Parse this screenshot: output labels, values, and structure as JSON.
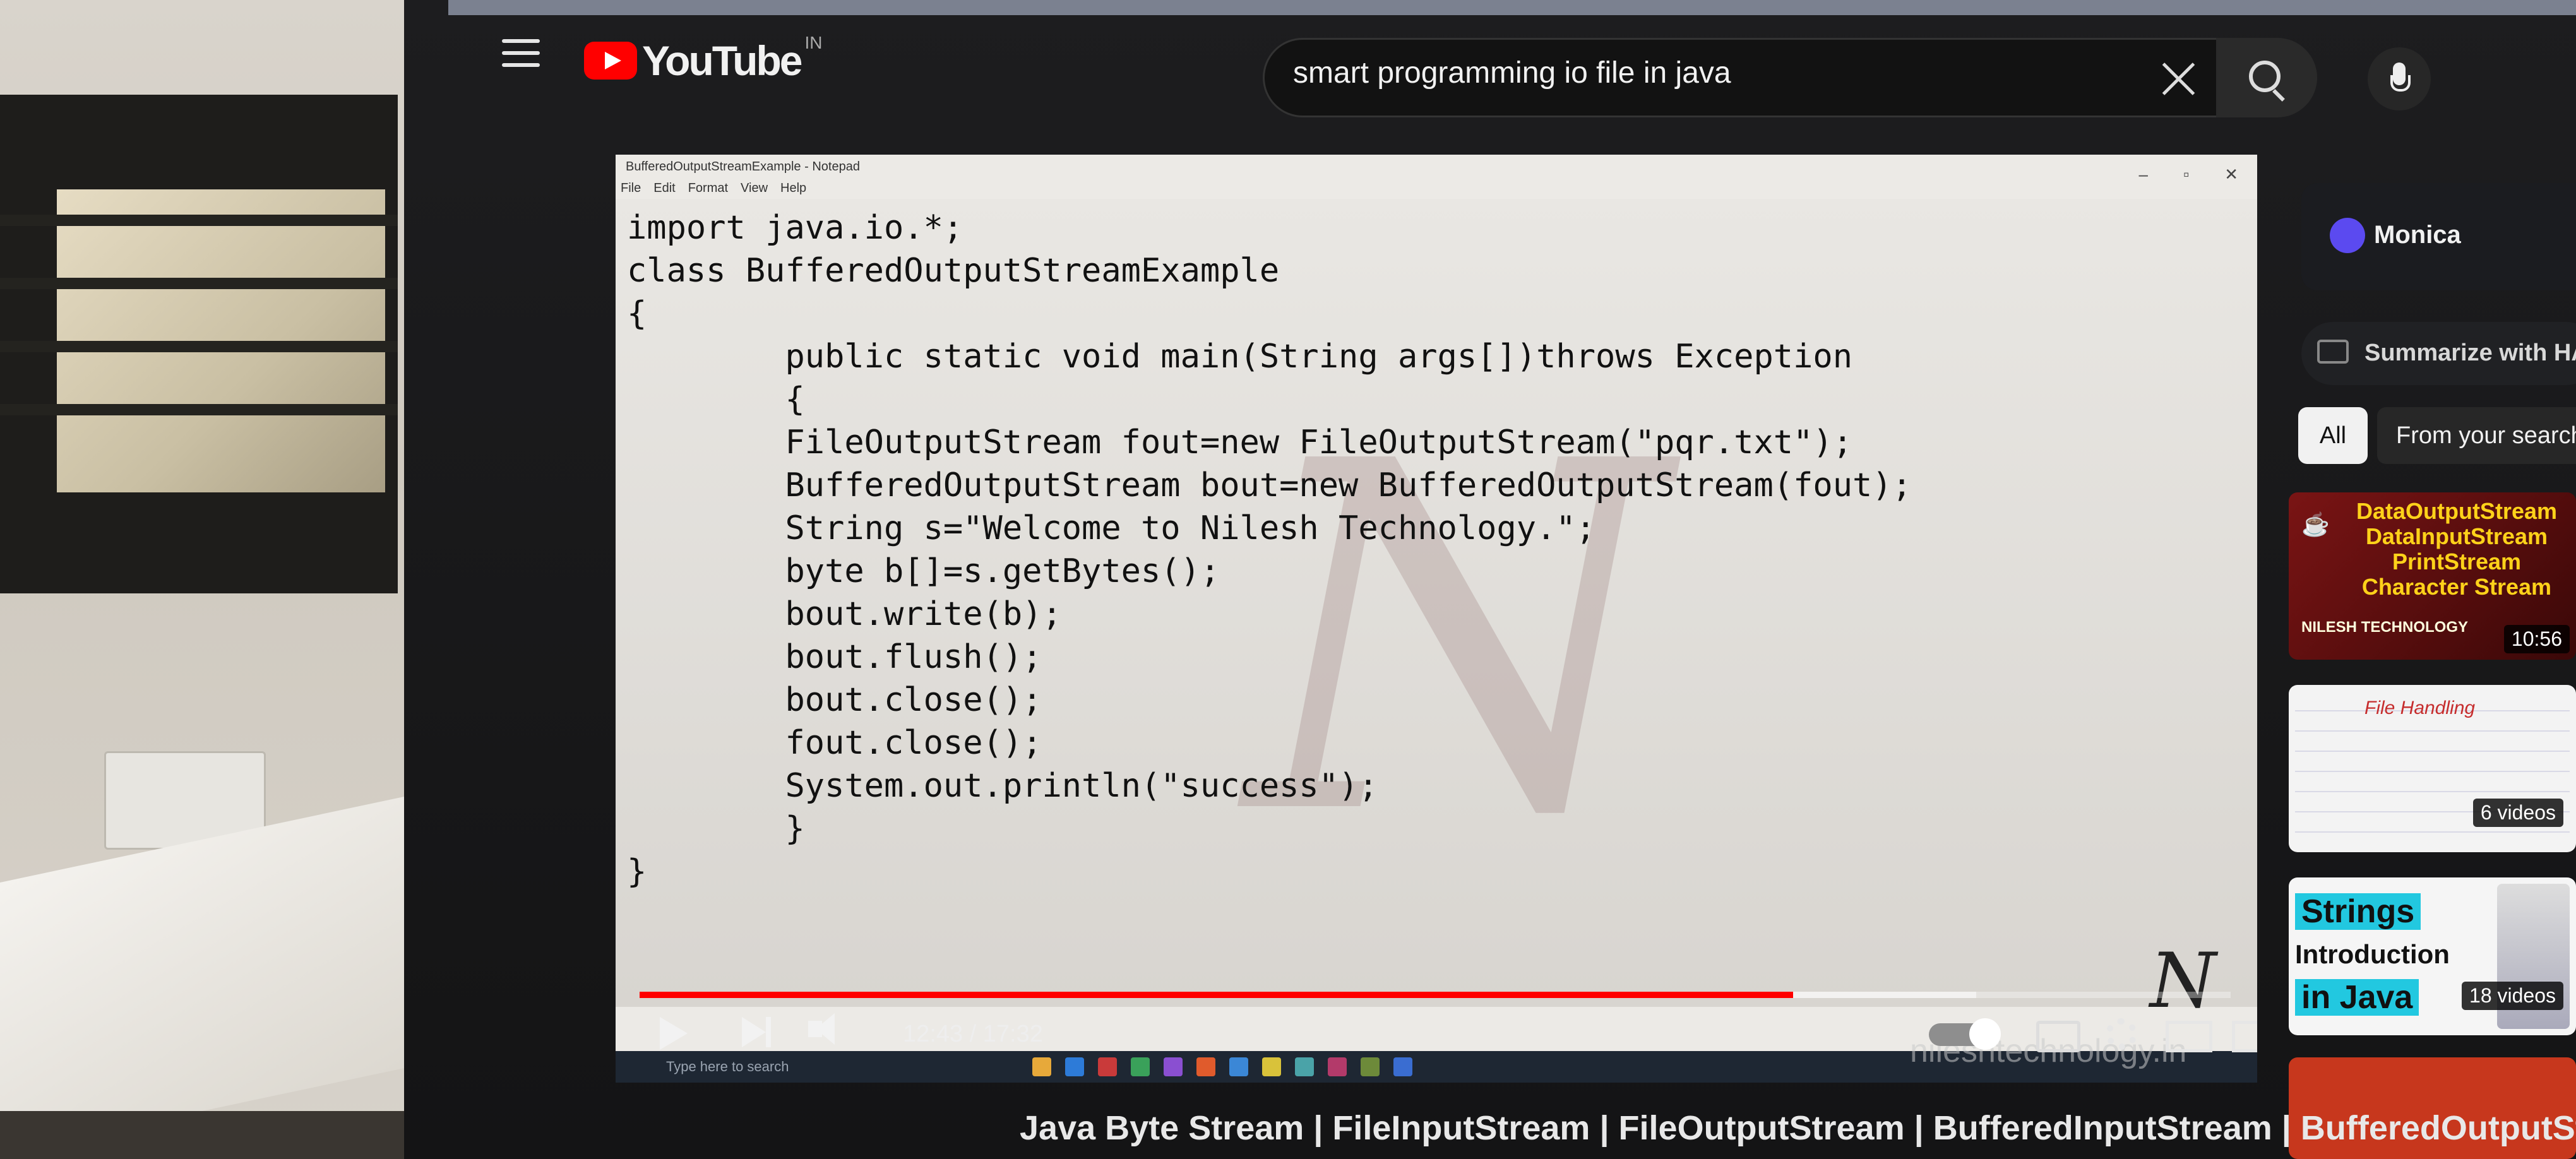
{
  "header": {
    "logo_text": "YouTube",
    "country_code": "IN",
    "search_query": "smart programming io file in java"
  },
  "notepad": {
    "window_title": "BufferedOutputStreamExample - Notepad",
    "menu": [
      "File",
      "Edit",
      "Format",
      "View",
      "Help"
    ],
    "code_lines": [
      "import java.io.*;",
      "class BufferedOutputStreamExample",
      "{",
      "        public static void main(String args[])throws Exception",
      "        {",
      "        FileOutputStream fout=new FileOutputStream(\"pqr.txt\");",
      "        BufferedOutputStream bout=new BufferedOutputStream(fout);",
      "        String s=\"Welcome to Nilesh Technology.\";",
      "        byte b[]=s.getBytes();",
      "        bout.write(b);",
      "        bout.flush();",
      "        bout.close();",
      "        fout.close();",
      "        System.out.println(\"success\");",
      "        }",
      "}"
    ]
  },
  "player": {
    "time_display": "12:43 / 17:32",
    "progress_fraction": 0.725,
    "buffer_fraction": 0.84,
    "overlay_url": "nileshtechnology.in",
    "taskbar_search_placeholder": "Type here to search"
  },
  "sidebar": {
    "monica_label": "Monica",
    "summarize_label": "Summarize with HAI",
    "chips": [
      "All",
      "From your search"
    ],
    "videos": [
      {
        "thumb_lines": [
          "DataOutputStream",
          "DataInputStream",
          "PrintStream",
          "Character Stream"
        ],
        "thumb_brand": "NILESH TECHNOLOGY",
        "duration": "10:56"
      },
      {
        "thumb_title": "File Handling",
        "badge": "6 videos"
      },
      {
        "thumb_lines": [
          "Strings",
          "Introduction",
          "in Java"
        ],
        "badge": "18 videos"
      },
      {}
    ]
  },
  "video_title": "Java Byte Stream | FileInputStream | FileOutputStream | BufferedInputStream | BufferedOutputStream",
  "colors": {
    "accent": "#ff0000",
    "chip_active": "#f1f1f1"
  }
}
